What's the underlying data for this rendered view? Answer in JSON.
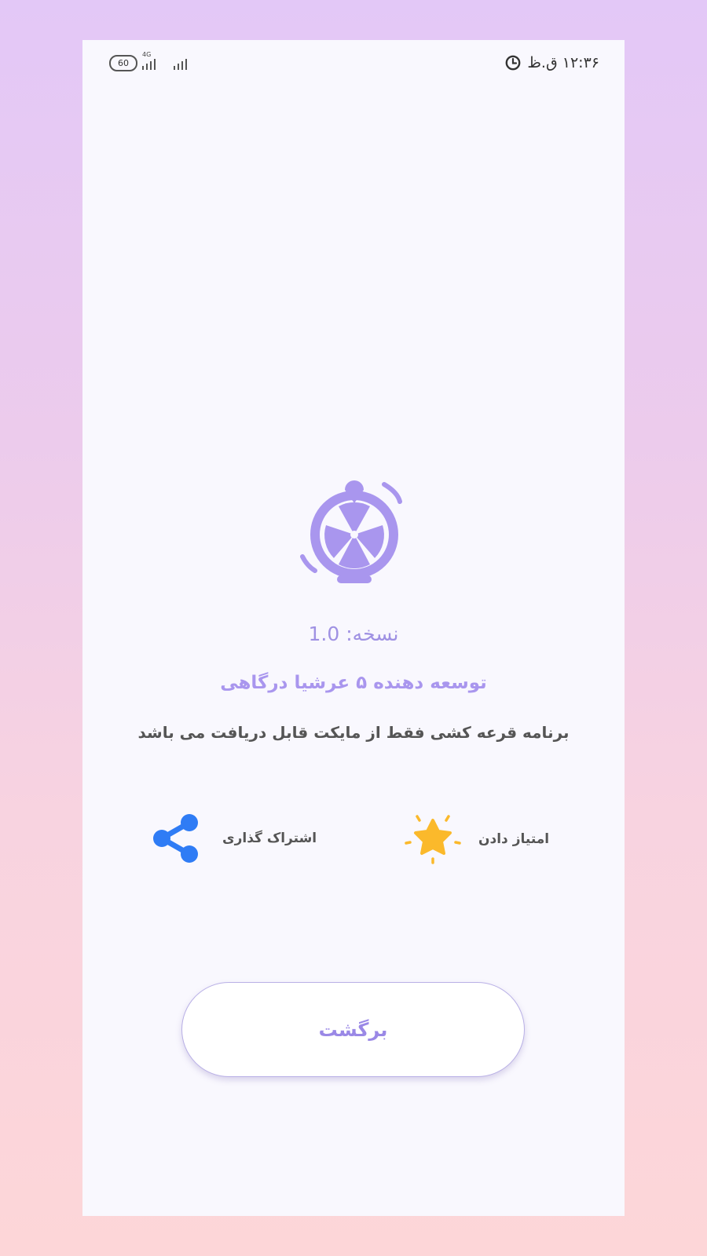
{
  "status_bar": {
    "time": "۱۲:۳۶ ق.ظ",
    "battery_level": "60",
    "network_type": "4G"
  },
  "about": {
    "version_text": "نسخه: 1.0",
    "developer_text": "توسعه دهنده ۵ عرشیا درگاهی",
    "notice_text": "برنامه قرعه کشی فقط از مایکت قابل دریافت می باشد"
  },
  "actions": {
    "rate_label": "امتیاز دادن",
    "share_label": "اشتراک گذاری"
  },
  "back_button_label": "برگشت",
  "colors": {
    "accent": "#a996ee",
    "rate_icon": "#fbb92b",
    "share_icon": "#2f7cf5"
  },
  "icons": {
    "logo": "prize-wheel-icon",
    "rate": "star-icon",
    "share": "share-icon",
    "clock": "clock-icon"
  }
}
